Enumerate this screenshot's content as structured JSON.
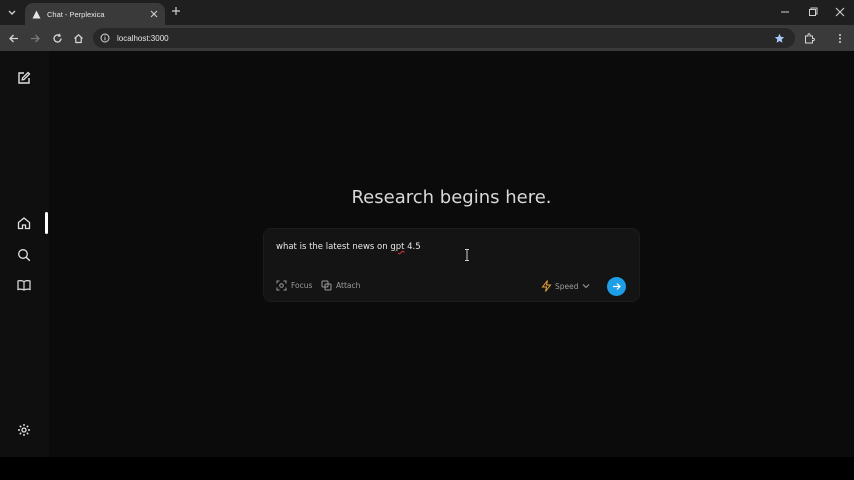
{
  "browser": {
    "tab_title": "Chat - Perplexica",
    "url": "localhost:3000"
  },
  "main": {
    "headline": "Research begins here.",
    "query_before": "what is the latest news on ",
    "query_misspelled": "gpt",
    "query_after": " 4.5",
    "focus_label": "Focus",
    "attach_label": "Attach",
    "mode_label": "Speed"
  },
  "colors": {
    "accent": "#1e9ee6",
    "speed_icon": "#e8a23a"
  }
}
